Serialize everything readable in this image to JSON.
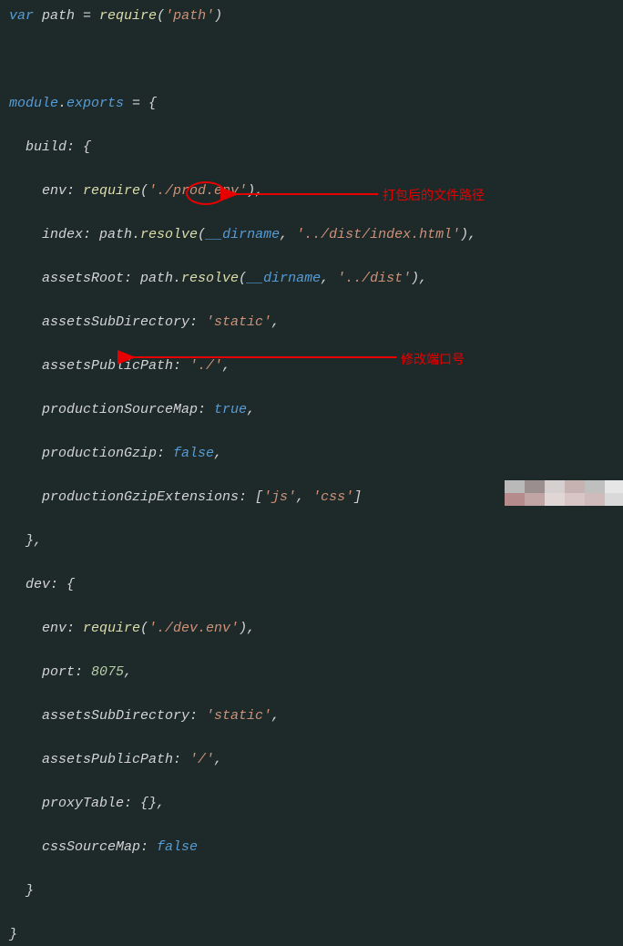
{
  "annotations": {
    "label1": "打包后的文件路径",
    "label2": "修改端口号"
  },
  "code": {
    "l1_var": "var",
    "l1_path": " path ",
    "l1_eq": "= ",
    "l1_req": "require",
    "l1_op": "(",
    "l1_str": "'path'",
    "l1_cp": ")",
    "l3_mod": "module",
    "l3_dot": ".",
    "l3_exp": "exports",
    "l3_eq": " = {",
    "l4": "  build: {",
    "l5_ind": "    env: ",
    "l5_req": "require",
    "l5_op": "(",
    "l5_str": "'./prod.env'",
    "l5_cp": "),",
    "l6_ind": "    index: path.",
    "l6_res": "resolve",
    "l6_op": "(",
    "l6_dir": "__dirname",
    "l6_c1": ", ",
    "l6_str": "'../dist/index.html'",
    "l6_cp": "),",
    "l7_ind": "    assetsRoot: path.",
    "l7_res": "resolve",
    "l7_op": "(",
    "l7_dir": "__dirname",
    "l7_c1": ", ",
    "l7_str": "'../dist'",
    "l7_cp": "),",
    "l8_ind": "    assetsSubDirectory: ",
    "l8_str": "'static'",
    "l8_end": ",",
    "l9_ind": "    assetsPublicPath: ",
    "l9_str": "'./'",
    "l9_end": ",",
    "l10_ind": "    productionSourceMap: ",
    "l10_b": "true",
    "l10_e": ",",
    "l11_ind": "    productionGzip: ",
    "l11_b": "false",
    "l11_e": ",",
    "l12_ind": "    productionGzipExtensions: [",
    "l12_s1": "'js'",
    "l12_c": ", ",
    "l12_s2": "'css'",
    "l12_e": "]",
    "l13": "  },",
    "l14": "  dev: {",
    "l15_ind": "    env: ",
    "l15_req": "require",
    "l15_op": "(",
    "l15_str": "'./dev.env'",
    "l15_cp": "),",
    "l16_ind": "    port: ",
    "l16_num": "8075",
    "l16_e": ",",
    "l17_ind": "    assetsSubDirectory: ",
    "l17_str": "'static'",
    "l17_e": ",",
    "l18_ind": "    assetsPublicPath: ",
    "l18_str": "'/'",
    "l18_e": ",",
    "l19": "    proxyTable: {},",
    "l20_ind": "    cssSourceMap: ",
    "l20_b": "false",
    "l21": "  }",
    "l22": "}"
  }
}
